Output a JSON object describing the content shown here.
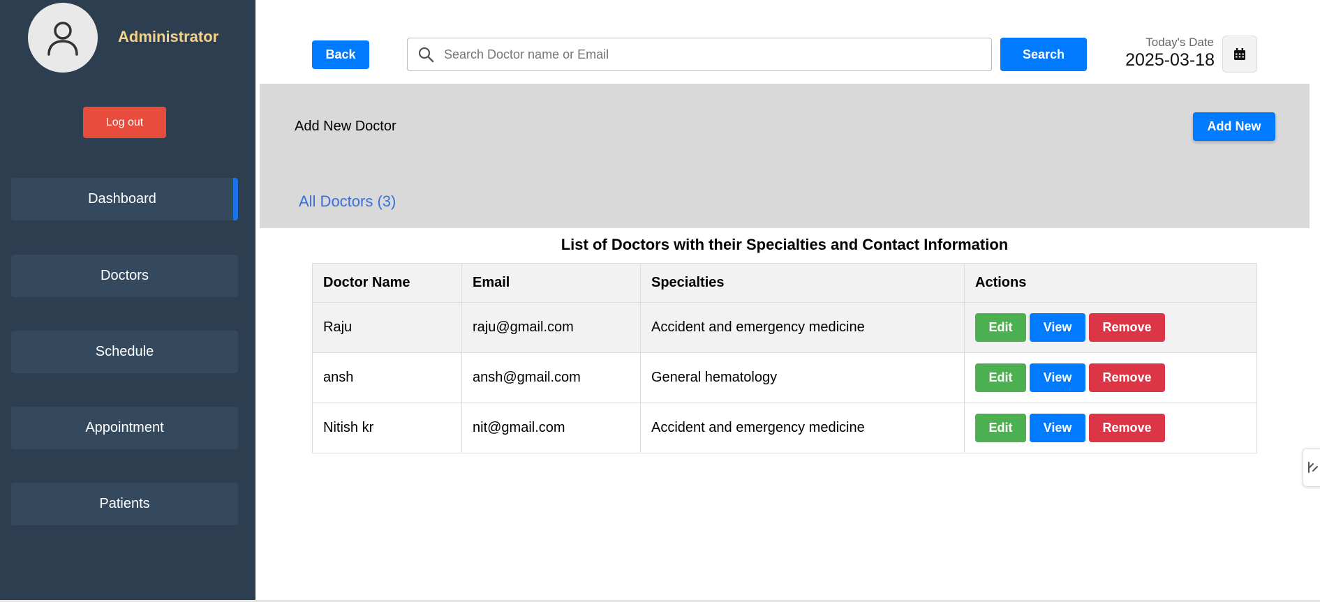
{
  "sidebar": {
    "admin_name": "Administrator",
    "logout_label": "Log out",
    "nav": [
      {
        "label": "Dashboard",
        "active": true
      },
      {
        "label": "Doctors",
        "active": false
      },
      {
        "label": "Schedule",
        "active": false
      },
      {
        "label": "Appointment",
        "active": false
      },
      {
        "label": "Patients",
        "active": false
      }
    ]
  },
  "topbar": {
    "back_label": "Back",
    "search_placeholder": "Search Doctor name or Email",
    "search_label": "Search",
    "date_label": "Today's Date",
    "date_value": "2025-03-18"
  },
  "panel": {
    "add_label": "Add New Doctor",
    "add_button": "Add New",
    "all_doctors": "All Doctors (3)"
  },
  "table": {
    "caption": "List of Doctors with their Specialties and Contact Information",
    "headers": [
      "Doctor Name",
      "Email",
      "Specialties",
      "Actions"
    ],
    "rows": [
      {
        "name": "Raju",
        "email": "raju@gmail.com",
        "specialty": "Accident and emergency medicine"
      },
      {
        "name": "ansh",
        "email": "ansh@gmail.com",
        "specialty": "General hematology"
      },
      {
        "name": "Nitish kr",
        "email": "nit@gmail.com",
        "specialty": "Accident and emergency medicine"
      }
    ],
    "actions": {
      "edit": "Edit",
      "view": "View",
      "remove": "Remove"
    }
  },
  "colors": {
    "sidebar_bg": "#2c3e50",
    "nav_item_bg": "#34495e",
    "primary": "#007bff",
    "danger": "#dc3545",
    "success": "#4caf50",
    "logout": "#e74c3c",
    "admin_name": "#f5d28c"
  },
  "icons": [
    "user-avatar-icon",
    "search-icon",
    "calendar-icon",
    "side-panel-icon"
  ]
}
